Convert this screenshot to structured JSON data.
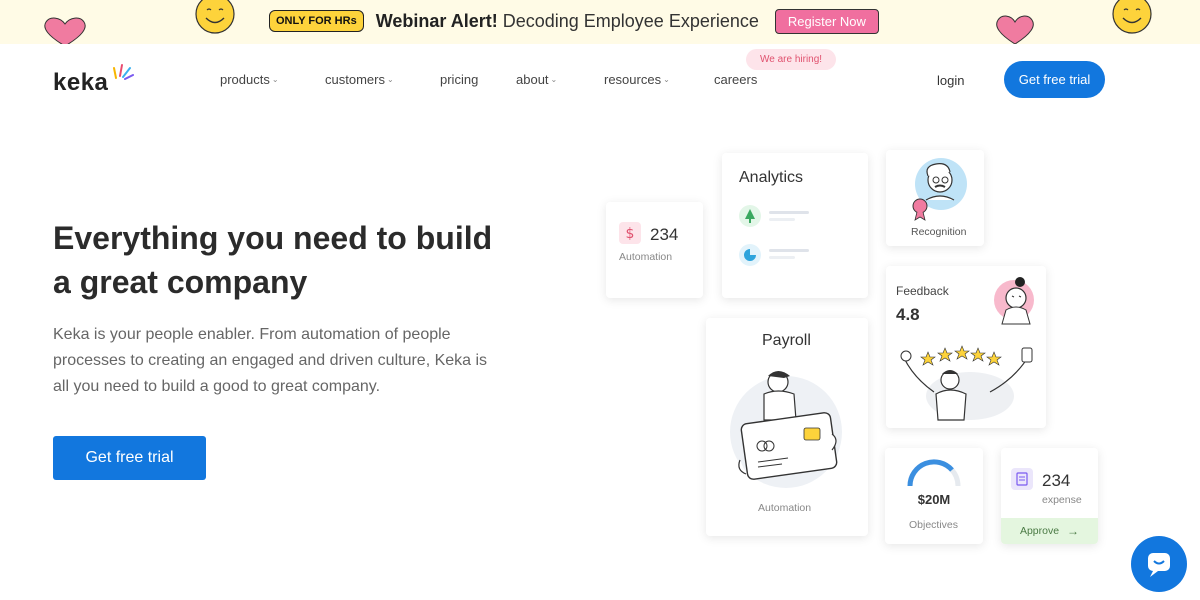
{
  "banner": {
    "badge": "ONLY FOR HRs",
    "alert_bold": "Webinar Alert!",
    "alert_text": " Decoding Employee Experience",
    "register_label": "Register Now"
  },
  "nav": {
    "logo": "keka",
    "items": [
      {
        "label": "products",
        "dropdown": true
      },
      {
        "label": "customers",
        "dropdown": true
      },
      {
        "label": "pricing",
        "dropdown": false
      },
      {
        "label": "about",
        "dropdown": true
      },
      {
        "label": "resources",
        "dropdown": true
      },
      {
        "label": "careers",
        "dropdown": false
      }
    ],
    "hiring_badge": "We are hiring!",
    "login": "login",
    "cta": "Get free trial"
  },
  "hero": {
    "title": "Everything you need to build a great company",
    "description": "Keka is your people enabler. From automation of people processes to creating an engaged and driven culture, Keka is all you need to build a good to great company.",
    "cta": "Get free trial"
  },
  "cards": {
    "automation": {
      "value": "234",
      "label": "Automation"
    },
    "analytics": {
      "title": "Analytics"
    },
    "recognition": {
      "label": "Recognition"
    },
    "feedback": {
      "title": "Feedback",
      "rating": "4.8"
    },
    "payroll": {
      "title": "Payroll",
      "label": "Automation"
    },
    "objectives": {
      "value": "$20M",
      "label": "Objectives"
    },
    "expense": {
      "value": "234",
      "label": "expense",
      "action": "Approve"
    }
  },
  "colors": {
    "primary": "#1277de",
    "banner_bg": "#fffbe6",
    "badge_yellow": "#fdd33b",
    "pink": "#f06f9f",
    "approve_bg": "#e4f6df"
  },
  "icons": [
    "smiley-icon",
    "heart-icon",
    "chevron-down-icon",
    "dollar-icon",
    "tree-icon",
    "pie-icon",
    "receipt-icon",
    "arrow-right-icon",
    "chat-icon"
  ]
}
